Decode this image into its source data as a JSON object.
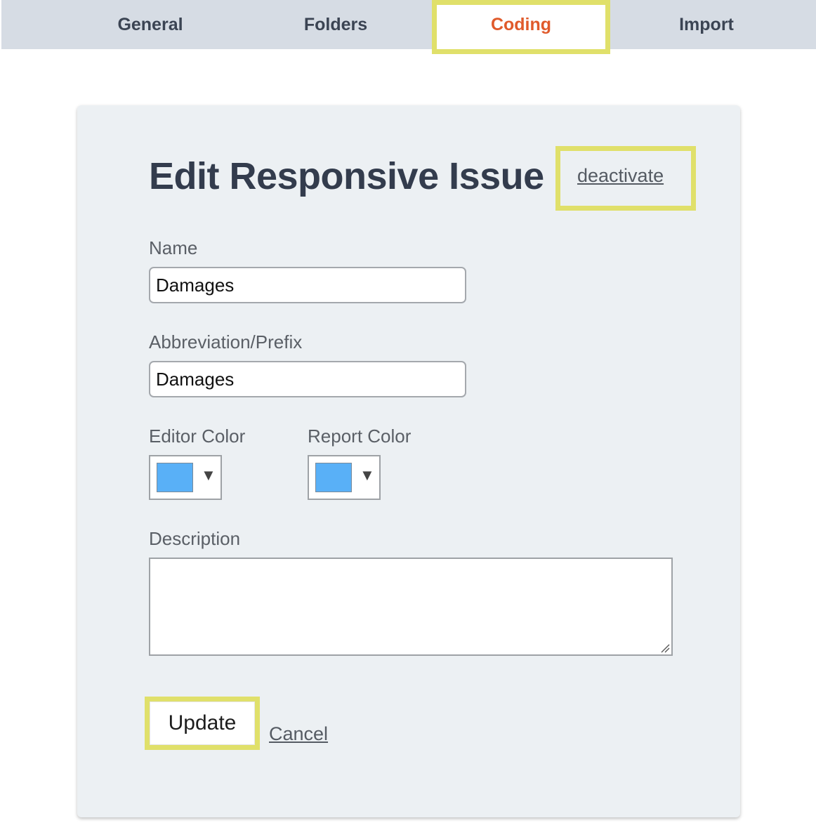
{
  "tabs": [
    {
      "label": "General",
      "active": false
    },
    {
      "label": "Folders",
      "active": false
    },
    {
      "label": "Coding",
      "active": true
    },
    {
      "label": "Import",
      "active": false
    }
  ],
  "panel": {
    "title": "Edit Responsive Issue",
    "deactivate_label": "deactivate",
    "name_label": "Name",
    "name_value": "Damages",
    "abbr_label": "Abbreviation/Prefix",
    "abbr_value": "Damages",
    "editor_color_label": "Editor Color",
    "editor_color_value": "#59b0f7",
    "report_color_label": "Report Color",
    "report_color_value": "#59b0f7",
    "description_label": "Description",
    "description_value": "",
    "update_label": "Update",
    "cancel_label": "Cancel"
  },
  "icons": {
    "dropdown_caret": "▼"
  },
  "colors": {
    "accent_tab": "#e05a2b",
    "highlight_outline": "#e0e06a",
    "tabbar_bg": "#d6dce4",
    "panel_bg": "#ecf0f3"
  }
}
